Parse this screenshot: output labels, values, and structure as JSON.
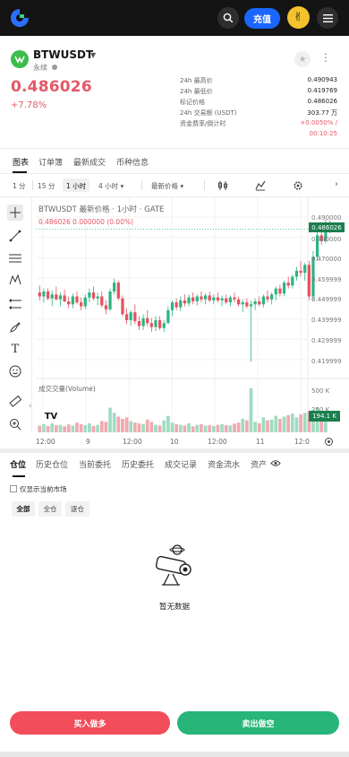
{
  "topbar": {
    "deposit_label": "充值",
    "avatar_emoji": "✌"
  },
  "ticker": {
    "symbol": "BTWUSDT",
    "type": "永续",
    "last_price": "0.486026",
    "change_pct": "+7.78%",
    "stats": [
      {
        "label": "24h 最高价",
        "value": "0.490943"
      },
      {
        "label": "24h 最低价",
        "value": "0.419769"
      },
      {
        "label": "标记价格",
        "value": "0.486026"
      },
      {
        "label": "24h 交易额 (USDT)",
        "value": "303.77 万"
      },
      {
        "label": "资金费率/倒计时",
        "value": "+0.0050% /"
      },
      {
        "label": "",
        "value": "00:10:25"
      }
    ]
  },
  "tabs": [
    "图表",
    "订单簿",
    "最新成交",
    "币种信息"
  ],
  "timeframes": {
    "items": [
      "1 分",
      "15 分",
      "1 小时",
      "4 小时 ▾"
    ],
    "price_type": "最新价格 ▾"
  },
  "chart_data": {
    "type": "candlestick",
    "legend_title": "BTWUSDT 最新价格 · 1小时 · GATE",
    "legend_values": "0.486026  0.000000 (0.00%)",
    "volume_legend": "成交交量(Volume)",
    "y_ticks": [
      "0.490000",
      "0.480000",
      "0.470000",
      "0.459999",
      "0.449999",
      "0.439999",
      "0.429999",
      "0.419999"
    ],
    "last_price_tag": "0.486026",
    "volume_ticks": [
      "500 K",
      "250 K"
    ],
    "volume_tag": "194.1 K",
    "x_ticks": [
      "12:00",
      "9",
      "12:00",
      "10",
      "12:00",
      "11",
      "12:0"
    ],
    "ylim": [
      0.415,
      0.494
    ],
    "volume_max": 600,
    "candles": [
      [
        0.454,
        0.4575,
        0.45,
        0.452
      ],
      [
        0.452,
        0.456,
        0.449,
        0.4545
      ],
      [
        0.4545,
        0.456,
        0.45,
        0.451
      ],
      [
        0.451,
        0.455,
        0.447,
        0.453
      ],
      [
        0.453,
        0.457,
        0.45,
        0.4505
      ],
      [
        0.4505,
        0.454,
        0.447,
        0.4525
      ],
      [
        0.4525,
        0.4555,
        0.449,
        0.4495
      ],
      [
        0.4495,
        0.452,
        0.446,
        0.448
      ],
      [
        0.448,
        0.4535,
        0.446,
        0.452
      ],
      [
        0.452,
        0.4545,
        0.448,
        0.449
      ],
      [
        0.449,
        0.4515,
        0.445,
        0.447
      ],
      [
        0.447,
        0.453,
        0.4455,
        0.4515
      ],
      [
        0.4515,
        0.456,
        0.449,
        0.454
      ],
      [
        0.454,
        0.457,
        0.45,
        0.451
      ],
      [
        0.451,
        0.454,
        0.4475,
        0.452
      ],
      [
        0.452,
        0.4545,
        0.4465,
        0.4475
      ],
      [
        0.4475,
        0.45,
        0.443,
        0.4455
      ],
      [
        0.4455,
        0.456,
        0.4445,
        0.4545
      ],
      [
        0.4545,
        0.461,
        0.453,
        0.459
      ],
      [
        0.459,
        0.46,
        0.45,
        0.451
      ],
      [
        0.451,
        0.4525,
        0.442,
        0.443
      ],
      [
        0.443,
        0.446,
        0.438,
        0.44
      ],
      [
        0.44,
        0.445,
        0.437,
        0.444
      ],
      [
        0.444,
        0.448,
        0.438,
        0.4395
      ],
      [
        0.4395,
        0.442,
        0.435,
        0.437
      ],
      [
        0.437,
        0.443,
        0.435,
        0.441
      ],
      [
        0.441,
        0.445,
        0.437,
        0.4385
      ],
      [
        0.4385,
        0.441,
        0.434,
        0.4365
      ],
      [
        0.4365,
        0.442,
        0.4345,
        0.44
      ],
      [
        0.44,
        0.442,
        0.435,
        0.436
      ],
      [
        0.436,
        0.44,
        0.434,
        0.4385
      ],
      [
        0.4385,
        0.447,
        0.438,
        0.445
      ],
      [
        0.445,
        0.45,
        0.442,
        0.449
      ],
      [
        0.449,
        0.451,
        0.445,
        0.4465
      ],
      [
        0.4465,
        0.452,
        0.4445,
        0.45
      ],
      [
        0.45,
        0.453,
        0.447,
        0.4485
      ],
      [
        0.4485,
        0.453,
        0.447,
        0.4515
      ],
      [
        0.4515,
        0.454,
        0.448,
        0.4495
      ],
      [
        0.4495,
        0.453,
        0.4475,
        0.452
      ],
      [
        0.452,
        0.4545,
        0.449,
        0.4505
      ],
      [
        0.4505,
        0.4535,
        0.448,
        0.4525
      ],
      [
        0.4525,
        0.4545,
        0.449,
        0.45
      ],
      [
        0.45,
        0.453,
        0.448,
        0.4515
      ],
      [
        0.4515,
        0.454,
        0.449,
        0.45
      ],
      [
        0.45,
        0.4525,
        0.447,
        0.451
      ],
      [
        0.451,
        0.453,
        0.448,
        0.449
      ],
      [
        0.449,
        0.4525,
        0.447,
        0.4515
      ],
      [
        0.4515,
        0.454,
        0.449,
        0.4505
      ],
      [
        0.4505,
        0.452,
        0.447,
        0.448
      ],
      [
        0.448,
        0.4505,
        0.444,
        0.449
      ],
      [
        0.449,
        0.451,
        0.446,
        0.447
      ],
      [
        0.447,
        0.45,
        0.419,
        0.448
      ],
      [
        0.448,
        0.451,
        0.445,
        0.4495
      ],
      [
        0.4495,
        0.452,
        0.447,
        0.448
      ],
      [
        0.448,
        0.453,
        0.4465,
        0.452
      ],
      [
        0.452,
        0.455,
        0.449,
        0.4505
      ],
      [
        0.4505,
        0.454,
        0.448,
        0.453
      ],
      [
        0.453,
        0.457,
        0.45,
        0.456
      ],
      [
        0.456,
        0.458,
        0.452,
        0.4535
      ],
      [
        0.4535,
        0.46,
        0.452,
        0.459
      ],
      [
        0.459,
        0.462,
        0.456,
        0.4575
      ],
      [
        0.4575,
        0.463,
        0.456,
        0.462
      ],
      [
        0.462,
        0.467,
        0.46,
        0.465
      ],
      [
        0.465,
        0.47,
        0.462,
        0.464
      ],
      [
        0.464,
        0.469,
        0.46,
        0.468
      ],
      [
        0.468,
        0.47,
        0.45,
        0.452
      ],
      [
        0.452,
        0.475,
        0.45,
        0.472
      ],
      [
        0.472,
        0.485,
        0.47,
        0.483
      ],
      [
        0.483,
        0.488,
        0.478,
        0.48
      ],
      [
        0.48,
        0.491,
        0.479,
        0.487
      ],
      [
        0.487,
        0.4905,
        0.484,
        0.486
      ]
    ],
    "volumes": [
      90,
      110,
      85,
      120,
      95,
      100,
      80,
      105,
      90,
      130,
      110,
      95,
      120,
      85,
      100,
      150,
      140,
      330,
      260,
      210,
      180,
      200,
      150,
      130,
      120,
      110,
      170,
      140,
      100,
      90,
      160,
      220,
      130,
      110,
      100,
      90,
      120,
      80,
      100,
      110,
      90,
      95,
      85,
      100,
      110,
      95,
      90,
      115,
      130,
      180,
      160,
      590,
      140,
      120,
      200,
      160,
      170,
      220,
      180,
      210,
      230,
      250,
      200,
      240,
      260,
      280,
      300,
      330,
      280,
      240
    ]
  },
  "positions": {
    "tabs": [
      "仓位",
      "历史仓位",
      "当前委托",
      "历史委托",
      "成交记录",
      "资金流水",
      "资产"
    ],
    "only_current": "仅显示当前市场",
    "segments": [
      "全部",
      "全仓",
      "逐仓"
    ],
    "empty_text": "暂无数据"
  },
  "actions": {
    "buy_label": "买入做多",
    "sell_label": "卖出做空"
  }
}
